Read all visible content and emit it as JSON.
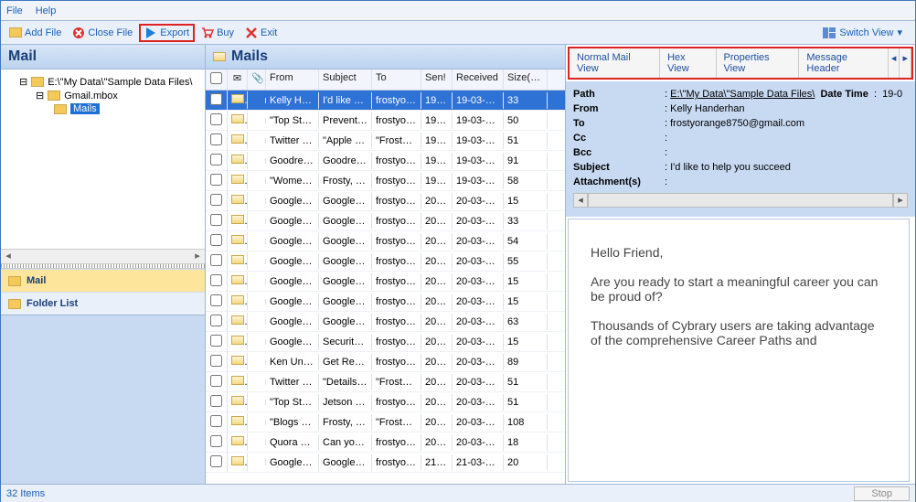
{
  "menu": {
    "file": "File",
    "help": "Help"
  },
  "toolbar": {
    "addfile": "Add File",
    "closefile": "Close File",
    "export": "Export",
    "buy": "Buy",
    "exit": "Exit",
    "switchview": "Switch View"
  },
  "left": {
    "title": "Mail",
    "tree": {
      "root": "E:\\\"My Data\\\"Sample Data Files\\",
      "mbox": "Gmail.mbox",
      "mails": "Mails"
    },
    "nav": {
      "mail": "Mail",
      "folderlist": "Folder List"
    }
  },
  "grid": {
    "title": "Mails",
    "cols": {
      "from": "From",
      "subject": "Subject",
      "to": "To",
      "sent": "Sen!",
      "received": "Received",
      "size": "Size(KB)"
    },
    "rows": [
      {
        "from": "Kelly Ha…",
        "subj": "I'd like …",
        "to": "frostyor…",
        "sent": "19…",
        "recv": "19-03-2…",
        "size": "33",
        "sel": true
      },
      {
        "from": "\"Top St…",
        "subj": "Prevent…",
        "to": "frostyor…",
        "sent": "19…",
        "recv": "19-03-2…",
        "size": "50"
      },
      {
        "from": "Twitter …",
        "subj": "\"Apple …",
        "to": "\"Frosty …",
        "sent": "19…",
        "recv": "19-03-2…",
        "size": "51"
      },
      {
        "from": "Goodre…",
        "subj": "Goodre…",
        "to": "frostyor…",
        "sent": "19…",
        "recv": "19-03-2…",
        "size": "91"
      },
      {
        "from": "\"Wome…",
        "subj": "Frosty, …",
        "to": "frostyor…",
        "sent": "19…",
        "recv": "19-03-2…",
        "size": "58"
      },
      {
        "from": "Google …",
        "subj": "Google …",
        "to": "frostyor…",
        "sent": "20…",
        "recv": "20-03-2…",
        "size": "15"
      },
      {
        "from": "Google …",
        "subj": "Google …",
        "to": "frostyor…",
        "sent": "20…",
        "recv": "20-03-2…",
        "size": "33"
      },
      {
        "from": "Google …",
        "subj": "Google …",
        "to": "frostyor…",
        "sent": "20…",
        "recv": "20-03-2…",
        "size": "54"
      },
      {
        "from": "Google …",
        "subj": "Google …",
        "to": "frostyor…",
        "sent": "20…",
        "recv": "20-03-2…",
        "size": "55"
      },
      {
        "from": "Google …",
        "subj": "Google …",
        "to": "frostyor…",
        "sent": "20…",
        "recv": "20-03-2…",
        "size": "15"
      },
      {
        "from": "Google …",
        "subj": "Google …",
        "to": "frostyor…",
        "sent": "20…",
        "recv": "20-03-2…",
        "size": "15"
      },
      {
        "from": "Google …",
        "subj": "Google …",
        "to": "frostyor…",
        "sent": "20…",
        "recv": "20-03-2…",
        "size": "63"
      },
      {
        "from": "Google …",
        "subj": "Security…",
        "to": "frostyor…",
        "sent": "20…",
        "recv": "20-03-2…",
        "size": "15"
      },
      {
        "from": "Ken Un…",
        "subj": "Get Res…",
        "to": "frostyor…",
        "sent": "20…",
        "recv": "20-03-2…",
        "size": "89"
      },
      {
        "from": "Twitter …",
        "subj": "\"Details…",
        "to": "\"Frosty …",
        "sent": "20…",
        "recv": "20-03-2…",
        "size": "51"
      },
      {
        "from": "\"Top St…",
        "subj": "Jetson …",
        "to": "frostyor…",
        "sent": "20…",
        "recv": "20-03-2…",
        "size": "51"
      },
      {
        "from": "\"Blogs …",
        "subj": "Frosty, …",
        "to": "\"Frosty …",
        "sent": "20…",
        "recv": "20-03-2…",
        "size": "108"
      },
      {
        "from": "Quora …",
        "subj": "Can yo…",
        "to": "frostyor…",
        "sent": "20…",
        "recv": "20-03-2…",
        "size": "18"
      },
      {
        "from": "Google …",
        "subj": "Google …",
        "to": "frostyor…",
        "sent": "21…",
        "recv": "21-03-2…",
        "size": "20"
      }
    ]
  },
  "preview": {
    "tabs": {
      "normal": "Normal Mail View",
      "hex": "Hex View",
      "props": "Properties View",
      "header": "Message Header"
    },
    "meta": {
      "path_k": "Path",
      "path_v": "E:\\\"My Data\\\"Sample Data Files\\",
      "datetime_k": "Date Time",
      "datetime_v": "19-0",
      "from_k": "From",
      "from_v": "Kelly Handerhan",
      "to_k": "To",
      "to_v": "frostyorange8750@gmail.com",
      "cc_k": "Cc",
      "cc_v": "",
      "bcc_k": "Bcc",
      "bcc_v": "",
      "subj_k": "Subject",
      "subj_v": "I'd like to help you succeed",
      "att_k": "Attachment(s)",
      "att_v": ""
    },
    "body": {
      "p1": "Hello Friend,",
      "p2": "Are you ready to start a meaningful career you can be proud of?",
      "p3": "Thousands of Cybrary users are taking advantage of the comprehensive Career Paths and"
    }
  },
  "status": {
    "items": "32 Items",
    "stop": "Stop"
  }
}
